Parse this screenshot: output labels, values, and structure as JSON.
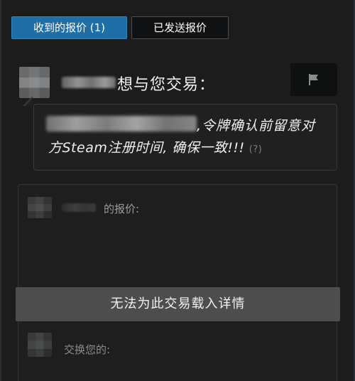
{
  "tabs": {
    "received": "收到的报价 (1)",
    "sent": "已发送报价"
  },
  "header": {
    "trade_title": "想与您交易："
  },
  "message": {
    "line1": ",令牌确认前留意对",
    "line2": "方Steam注册时间, 确保一致!!!",
    "help": "(?)"
  },
  "offer": {
    "their_offer_label": "的报价:",
    "your_exchange_label": "交换您的:",
    "error_text": "无法为此交易载入详情"
  },
  "icons": {
    "flag": "flag-icon"
  },
  "colors": {
    "active_tab": "#1f6ea6",
    "background": "#1c1c1d",
    "error_banner": "#4d4d4d"
  }
}
